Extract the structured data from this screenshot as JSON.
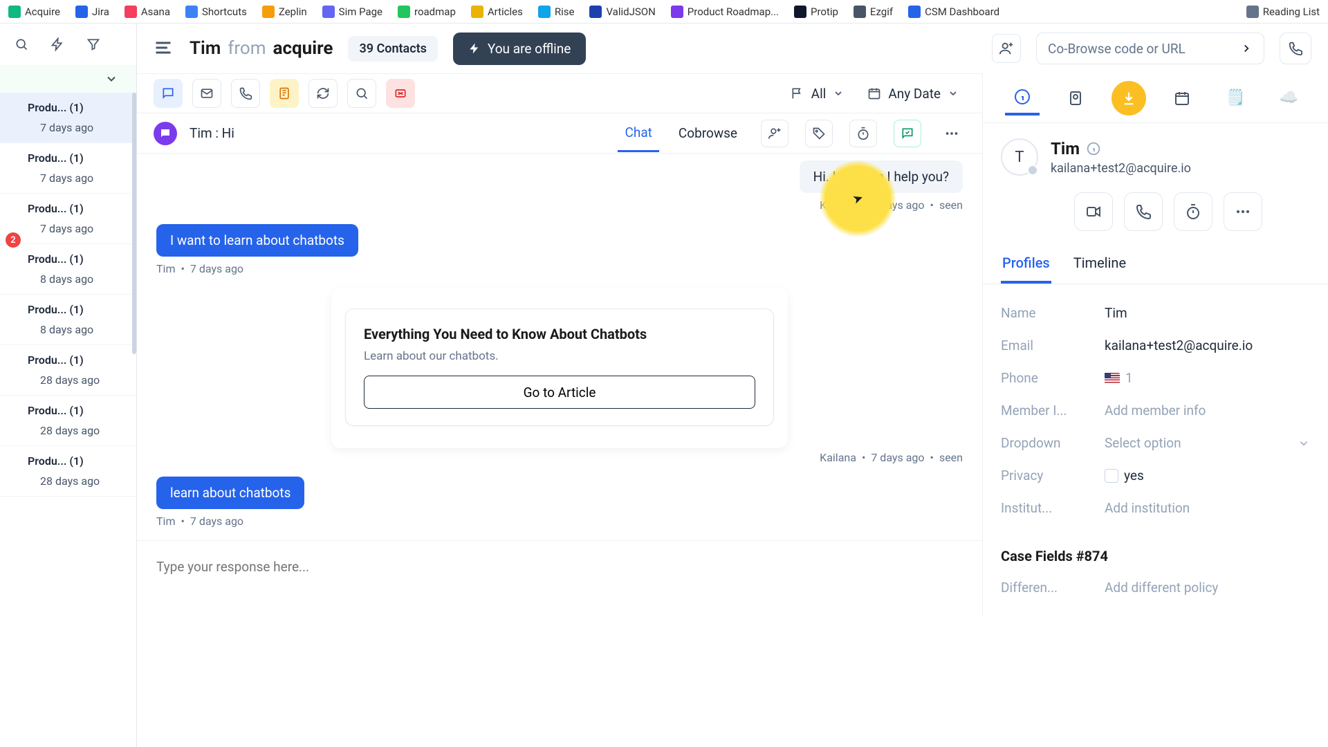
{
  "bookmarks": [
    {
      "label": "Acquire",
      "color": "#10b981"
    },
    {
      "label": "Jira",
      "color": "#2563eb"
    },
    {
      "label": "Asana",
      "color": "#f43f5e"
    },
    {
      "label": "Shortcuts",
      "color": "#3b82f6"
    },
    {
      "label": "Zeplin",
      "color": "#f59e0b"
    },
    {
      "label": "Sim Page",
      "color": "#6366f1"
    },
    {
      "label": "roadmap",
      "color": "#22c55e"
    },
    {
      "label": "Articles",
      "color": "#eab308"
    },
    {
      "label": "Rise",
      "color": "#0ea5e9"
    },
    {
      "label": "ValidJSON",
      "color": "#1e40af"
    },
    {
      "label": "Product Roadmap...",
      "color": "#7c3aed"
    },
    {
      "label": "Protip",
      "color": "#0f172a"
    },
    {
      "label": "Ezgif",
      "color": "#475569"
    },
    {
      "label": "CSM Dashboard",
      "color": "#2563eb"
    }
  ],
  "reading_list": "Reading List",
  "header": {
    "name": "Tim",
    "from": "from",
    "org": "acquire",
    "contacts": "39 Contacts",
    "offline": "You are offline",
    "cobrowse_placeholder": "Co-Browse code or URL"
  },
  "filters": {
    "all": "All",
    "any_date": "Any Date"
  },
  "conversations": [
    {
      "title": "Produ...  (1)",
      "time": "7 days ago",
      "active": true
    },
    {
      "title": "Produ...  (1)",
      "time": "7 days ago"
    },
    {
      "title": "Produ...  (1)",
      "time": "7 days ago",
      "badge": "2"
    },
    {
      "title": "Produ...  (1)",
      "time": "8 days ago"
    },
    {
      "title": "Produ...  (1)",
      "time": "8 days ago"
    },
    {
      "title": "Produ...  (1)",
      "time": "28 days ago"
    },
    {
      "title": "Produ...  (1)",
      "time": "28 days ago"
    },
    {
      "title": "Produ...  (1)",
      "time": "28 days ago"
    }
  ],
  "thread": {
    "avatar_icon": "chat",
    "title": "Tim  : Hi",
    "tabs": {
      "chat": "Chat",
      "cobrowse": "Cobrowse"
    }
  },
  "messages": {
    "agent1_text": "Hi. How can I help you?",
    "agent1_meta_name": "Kailana",
    "agent1_meta_time": "7 days ago",
    "agent1_meta_seen": "seen",
    "user1_text": "I want to learn about chatbots",
    "user1_meta_name": "Tim",
    "user1_meta_time": "7 days ago",
    "card_title": "Everything You Need to Know About Chatbots",
    "card_sub": "Learn about our chatbots.",
    "card_btn": "Go to Article",
    "card_meta_name": "Kailana",
    "card_meta_time": "7 days ago",
    "card_meta_seen": "seen",
    "user2_text": "learn about chatbots",
    "user2_meta_name": "Tim",
    "user2_meta_time": "7 days ago"
  },
  "composer_placeholder": "Type your response here...",
  "profile": {
    "initial": "T",
    "name": "Tim",
    "email": "kailana+test2@acquire.io",
    "tabs": {
      "profiles": "Profiles",
      "timeline": "Timeline"
    },
    "fields": {
      "name_l": "Name",
      "name_v": "Tim",
      "email_l": "Email",
      "email_v": "kailana+test2@acquire.io",
      "phone_l": "Phone",
      "phone_v": "1",
      "member_l": "Member I...",
      "member_v": "Add member info",
      "dropdown_l": "Dropdown",
      "dropdown_v": "Select option",
      "privacy_l": "Privacy",
      "privacy_v": "yes",
      "inst_l": "Institut...",
      "inst_v": "Add institution"
    },
    "case_title": "Case Fields #874",
    "case_diff_l": "Differen...",
    "case_diff_v": "Add different policy"
  }
}
